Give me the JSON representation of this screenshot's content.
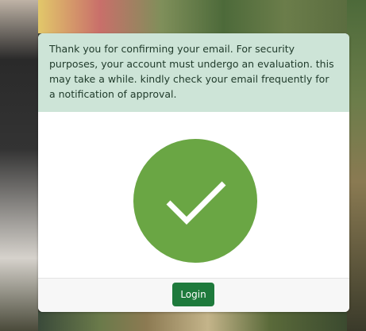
{
  "modal": {
    "message": "Thank you for confirming your email. For security purposes, your account must undergo an evaluation. this may take a while. kindly check your email frequently for a notification of approval.",
    "status_icon": "checkmark-icon",
    "login_label": "Login"
  },
  "colors": {
    "notice_bg": "#cde4d7",
    "check_circle": "#6aa644",
    "login_button": "#1e7a3c"
  }
}
